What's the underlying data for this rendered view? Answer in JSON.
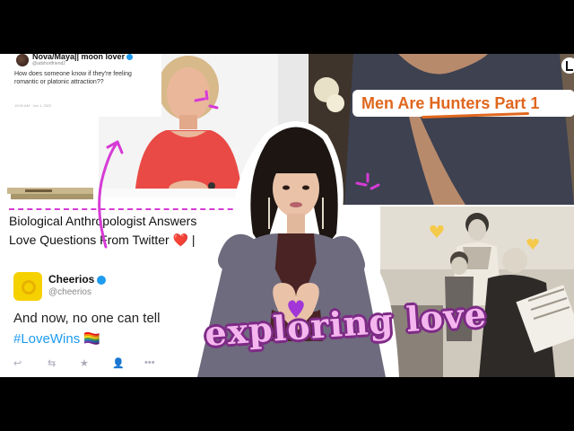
{
  "tweet_top": {
    "name": "Nova/Maya|| moon lover",
    "handle": "@adshortfriend2",
    "text": "How does someone know if they're feeling romantic or platonic attraction??",
    "time": "10:00 AM · Jun 1, 2022"
  },
  "video_title": "Men Are Hunters Part 1",
  "article": {
    "line1": "Biological Anthropologist Answers",
    "line2": "Love Questions From Twitter ❤️ |"
  },
  "cheerios_tweet": {
    "name": "Cheerios",
    "handle": "@cheerios",
    "text": "And now, no one can tell",
    "hashtag": "#LoveWins 🏳️‍🌈",
    "actions": [
      "reply-icon",
      "retweet-icon",
      "star-icon",
      "follow-icon",
      "more-icon"
    ]
  },
  "overlay_text": "exploring love",
  "colors": {
    "accent_pink": "#d63bd6",
    "overlay_fill": "#f5b6ef",
    "overlay_outline": "#7d2a86",
    "video_title_color": "#e0671e",
    "twitter_blue": "#1d9bf0",
    "cheerios_yellow": "#f6d100"
  }
}
